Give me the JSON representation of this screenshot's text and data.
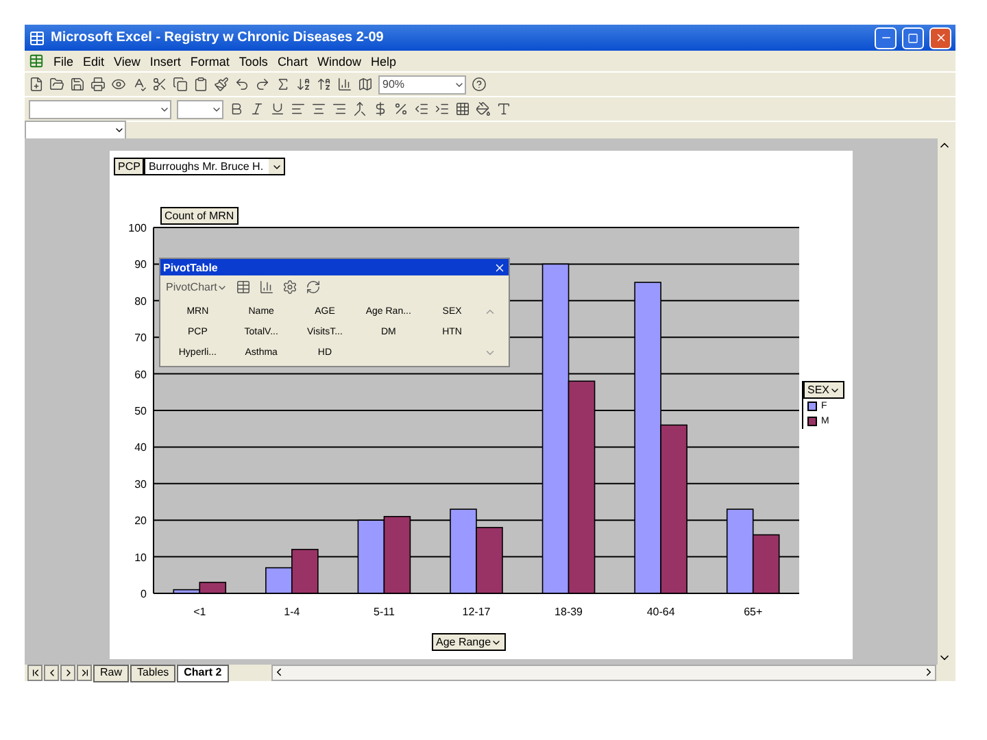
{
  "window": {
    "title": "Microsoft Excel - Registry w Chronic Diseases 2-09"
  },
  "menu": [
    "File",
    "Edit",
    "View",
    "Insert",
    "Format",
    "Tools",
    "Chart",
    "Window",
    "Help"
  ],
  "toolbar": {
    "zoom": "90%"
  },
  "chart": {
    "page_field": {
      "label": "PCP",
      "value": "Burroughs Mr. Bruce H."
    },
    "data_field": "Count of MRN",
    "axis_field": "Age Range",
    "legend_field": "SEX",
    "chart_data": {
      "type": "bar",
      "grid": true,
      "categories": [
        "<1",
        "1-4",
        "5-11",
        "12-17",
        "18-39",
        "40-64",
        "65+"
      ],
      "ylim": [
        0,
        100
      ],
      "yticks": [
        0,
        10,
        20,
        30,
        40,
        50,
        60,
        70,
        80,
        90,
        100
      ],
      "series": [
        {
          "name": "F",
          "color": "#9999ff",
          "values": [
            1,
            7,
            20,
            23,
            90,
            85,
            23
          ]
        },
        {
          "name": "M",
          "color": "#993366",
          "values": [
            3,
            12,
            21,
            18,
            58,
            46,
            16
          ]
        }
      ]
    }
  },
  "pivot_toolbar": {
    "title": "PivotTable",
    "menu": "PivotChart",
    "fields": [
      "MRN",
      "Name",
      "AGE",
      "Age Ran...",
      "SEX",
      "PCP",
      "TotalV...",
      "VisitsT...",
      "DM",
      "HTN",
      "Hyperli...",
      "Asthma",
      "HD"
    ]
  },
  "sheet_tabs": [
    {
      "label": "Raw",
      "selected": false
    },
    {
      "label": "Tables",
      "selected": false
    },
    {
      "label": "Chart 2",
      "selected": true
    }
  ]
}
